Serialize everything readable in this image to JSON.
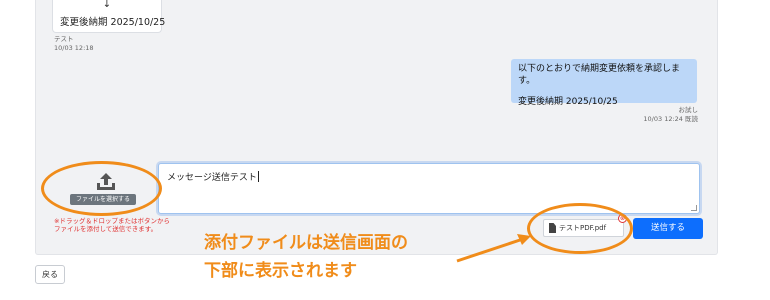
{
  "conversation": {
    "received": {
      "arrow": "↓",
      "date_line": "変更後納期 2025/10/25",
      "sender": "テスト",
      "time": "10/03 12:18"
    },
    "sent": {
      "line1": "以下のとおりで納期変更依頼を承認します。",
      "line2": "変更後納期 2025/10/25",
      "sender": "お試し",
      "time_status": "10/03 12:24 既読"
    }
  },
  "composer": {
    "upload_label": "ファイルを選択する",
    "help_line1": "※ドラッグ＆ドロップまたはボタンから",
    "help_line2": "ファイルを添付して送信できます。",
    "message_value": "メッセージ送信テスト",
    "attachment_name": "テストPDF.pdf",
    "remove_symbol": "⊗",
    "send_label": "送信する"
  },
  "footer": {
    "back_label": "戻る"
  },
  "annotation": {
    "line1": "添付ファイルは送信画面の",
    "line2": "下部に表示されます",
    "color": "#f08c1a"
  },
  "colors": {
    "primary": "#0d6efd",
    "sent_bubble": "#bcd7f8",
    "danger": "#e03131"
  }
}
